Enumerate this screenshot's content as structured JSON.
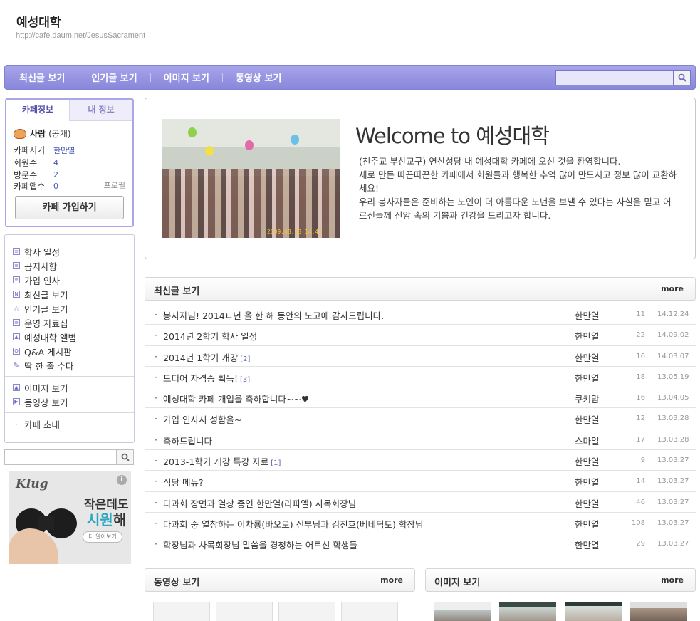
{
  "header": {
    "title": "예성대학",
    "url": "http://cafe.daum.net/JesusSacrament"
  },
  "nav": {
    "items": [
      "최신글 보기",
      "인기글 보기",
      "이미지 보기",
      "동영상 보기"
    ],
    "search_placeholder": ""
  },
  "info_box": {
    "tabs": [
      "카페정보",
      "내 정보"
    ],
    "level_name": "사람",
    "level_note": "(공개)",
    "rows": [
      {
        "label": "카페지기",
        "value": "한만열"
      },
      {
        "label": "회원수",
        "value": "4"
      },
      {
        "label": "방문수",
        "value": "2"
      },
      {
        "label": "카페앱수",
        "value": "0"
      }
    ],
    "profile_link": "프로필",
    "join_button": "카페 가입하기"
  },
  "side_menu": {
    "group1": [
      {
        "label": "학사 일정",
        "icon": "board-icon"
      },
      {
        "label": "공지사항",
        "icon": "board-icon"
      },
      {
        "label": "가입 인사",
        "icon": "board-icon"
      },
      {
        "label": "최신글 보기",
        "icon": "new-icon"
      },
      {
        "label": "인기글 보기",
        "icon": "star-icon"
      },
      {
        "label": "운영 자료집",
        "icon": "board-icon"
      },
      {
        "label": "예성대학 앨범",
        "icon": "album-icon"
      },
      {
        "label": "Q&A 게시판",
        "icon": "qa-icon"
      },
      {
        "label": "딱 한 줄 수다",
        "icon": "pencil-icon"
      }
    ],
    "group2": [
      {
        "label": "이미지 보기",
        "icon": "image-icon"
      },
      {
        "label": "동영상 보기",
        "icon": "video-icon"
      }
    ],
    "group3": [
      {
        "label": "카페 초대"
      }
    ]
  },
  "ad": {
    "brand": "Klug",
    "line1": "작은데도",
    "line2a": "시원",
    "line2b": "해",
    "more": "더 알아보기",
    "info": "i"
  },
  "welcome": {
    "title": "Welcome to 예성대학",
    "photo_stamp": "2009.08.28 14:47",
    "lines": [
      "(천주교 부산교구) 연산성당 내 예성대학 카페에 오신 것을 환영합니다.",
      "새로 만든 따끈따끈한 카페에서 회원들과 행복한 추억 많이 만드시고 정보 많이 교환하세요!",
      "우리 봉사자들은 준비하는 노인이 더 아름다운 노년을 보낼 수 있다는 사실을 믿고 어르신들께 신앙 속의 기쁨과 건강을 드리고자 합니다."
    ]
  },
  "recent": {
    "title": "최신글 보기",
    "more": "more",
    "posts": [
      {
        "title": "봉사자님! 2014ㄴ년 올 한 해 동안의 노고에 감사드립니다.",
        "comments": "",
        "author": "한만열",
        "hits": "11",
        "date": "14.12.24"
      },
      {
        "title": "2014년 2학기 학사 일정",
        "comments": "",
        "author": "한만열",
        "hits": "22",
        "date": "14.09.02"
      },
      {
        "title": "2014년 1학기 개강",
        "comments": "[2]",
        "author": "한만열",
        "hits": "16",
        "date": "14.03.07"
      },
      {
        "title": "드디어 자격증 획득!",
        "comments": "[3]",
        "author": "한만열",
        "hits": "18",
        "date": "13.05.19"
      },
      {
        "title": "예성대학 카페 개업을 축하합니다~~♥",
        "comments": "",
        "author": "쿠키맘",
        "hits": "16",
        "date": "13.04.05"
      },
      {
        "title": "가입 인사시 성함을~",
        "comments": "",
        "author": "한만열",
        "hits": "12",
        "date": "13.03.28"
      },
      {
        "title": "축하드립니다",
        "comments": "",
        "author": "스마일",
        "hits": "17",
        "date": "13.03.28"
      },
      {
        "title": "2013-1학기 개강 특강 자료",
        "comments": "[1]",
        "author": "한만열",
        "hits": "9",
        "date": "13.03.27"
      },
      {
        "title": "식당 메뉴?",
        "comments": "",
        "author": "한만열",
        "hits": "14",
        "date": "13.03.27"
      },
      {
        "title": "다과회 장면과 열창 중인 한만열(라파엘) 사목회장님",
        "comments": "",
        "author": "한만열",
        "hits": "46",
        "date": "13.03.27"
      },
      {
        "title": "다과회 중 열창하는 이차룡(바오로) 신부님과 김진호(베네딕토) 학장님",
        "comments": "",
        "author": "한만열",
        "hits": "108",
        "date": "13.03.27"
      },
      {
        "title": "학장님과 사목회장님 말씀을 경청하는 어르신 학생들",
        "comments": "",
        "author": "한만열",
        "hits": "29",
        "date": "13.03.27"
      }
    ]
  },
  "video": {
    "title": "동영상 보기",
    "more": "more"
  },
  "images": {
    "title": "이미지 보기",
    "more": "more"
  },
  "colors": {
    "nav": "#9391df",
    "accent": "#5352a8",
    "link_count": "#4a56b0"
  }
}
